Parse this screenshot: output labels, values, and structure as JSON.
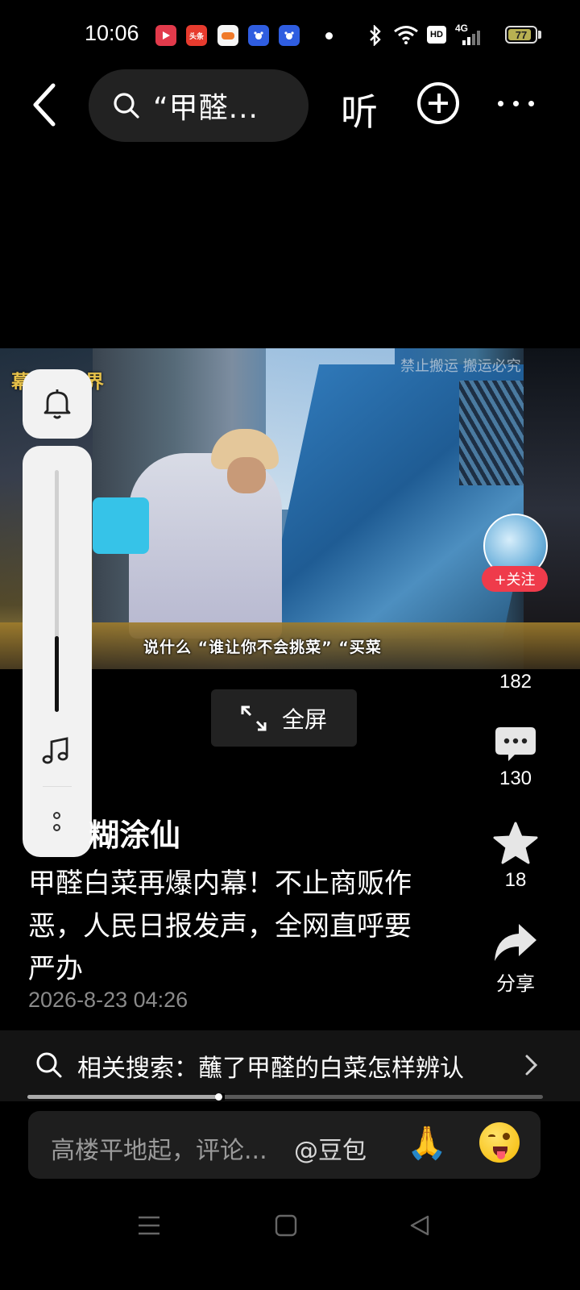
{
  "status_bar": {
    "time": "10:06",
    "network": "4G",
    "hd": "HD",
    "battery": "77",
    "apps": [
      {
        "name": "video-app",
        "color": "#e23a4b"
      },
      {
        "name": "toutiao",
        "label": "头条",
        "color": "#e73b2e"
      },
      {
        "name": "game-app",
        "color": "#f6f6f6"
      },
      {
        "name": "baidu-app",
        "color": "#2f5de0"
      },
      {
        "name": "baidu-app-2",
        "color": "#2f5de0"
      }
    ]
  },
  "top_bar": {
    "search_query": "“甲醛...",
    "listen_label": "听"
  },
  "video": {
    "watermark_left": "幕前视世界",
    "watermark_right": "禁止搬运 搬运必究",
    "subtitle": "说什么 “谁让你不会挑菜” “买菜"
  },
  "follow_label": "+关注",
  "fullscreen_label": "全屏",
  "actions": {
    "likes": "182",
    "comments": "130",
    "favorites": "18",
    "share_label": "分享"
  },
  "post": {
    "author": "糊涂仙",
    "title": "甲醛白菜再爆内幕！不止商贩作恶，人民日报发声，全网直呼要严办",
    "date": "2026-8-23 04:26"
  },
  "related_search": "相关搜索：蘸了甲醛的白菜怎样辨认",
  "progress": 0.37,
  "comment_bar": {
    "placeholder": "高楼平地起，评论...",
    "mention": "@豆包",
    "emoji_1": "🙏",
    "emoji_2": "😜"
  },
  "accent": "#ef3b4b"
}
